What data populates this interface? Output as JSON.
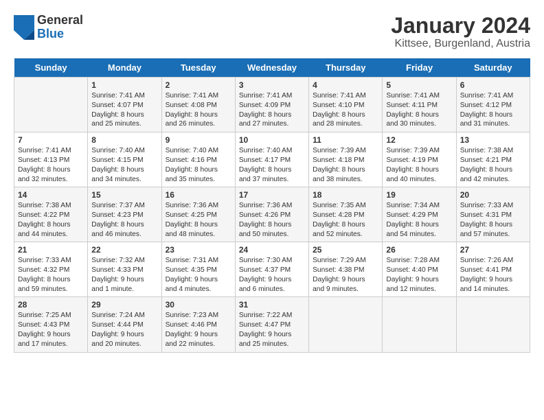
{
  "header": {
    "logo": {
      "general": "General",
      "blue": "Blue"
    },
    "title": "January 2024",
    "subtitle": "Kittsee, Burgenland, Austria"
  },
  "days_of_week": [
    "Sunday",
    "Monday",
    "Tuesday",
    "Wednesday",
    "Thursday",
    "Friday",
    "Saturday"
  ],
  "weeks": [
    [
      {
        "day": "",
        "content": ""
      },
      {
        "day": "1",
        "content": "Sunrise: 7:41 AM\nSunset: 4:07 PM\nDaylight: 8 hours\nand 25 minutes."
      },
      {
        "day": "2",
        "content": "Sunrise: 7:41 AM\nSunset: 4:08 PM\nDaylight: 8 hours\nand 26 minutes."
      },
      {
        "day": "3",
        "content": "Sunrise: 7:41 AM\nSunset: 4:09 PM\nDaylight: 8 hours\nand 27 minutes."
      },
      {
        "day": "4",
        "content": "Sunrise: 7:41 AM\nSunset: 4:10 PM\nDaylight: 8 hours\nand 28 minutes."
      },
      {
        "day": "5",
        "content": "Sunrise: 7:41 AM\nSunset: 4:11 PM\nDaylight: 8 hours\nand 30 minutes."
      },
      {
        "day": "6",
        "content": "Sunrise: 7:41 AM\nSunset: 4:12 PM\nDaylight: 8 hours\nand 31 minutes."
      }
    ],
    [
      {
        "day": "7",
        "content": "Sunrise: 7:41 AM\nSunset: 4:13 PM\nDaylight: 8 hours\nand 32 minutes."
      },
      {
        "day": "8",
        "content": "Sunrise: 7:40 AM\nSunset: 4:15 PM\nDaylight: 8 hours\nand 34 minutes."
      },
      {
        "day": "9",
        "content": "Sunrise: 7:40 AM\nSunset: 4:16 PM\nDaylight: 8 hours\nand 35 minutes."
      },
      {
        "day": "10",
        "content": "Sunrise: 7:40 AM\nSunset: 4:17 PM\nDaylight: 8 hours\nand 37 minutes."
      },
      {
        "day": "11",
        "content": "Sunrise: 7:39 AM\nSunset: 4:18 PM\nDaylight: 8 hours\nand 38 minutes."
      },
      {
        "day": "12",
        "content": "Sunrise: 7:39 AM\nSunset: 4:19 PM\nDaylight: 8 hours\nand 40 minutes."
      },
      {
        "day": "13",
        "content": "Sunrise: 7:38 AM\nSunset: 4:21 PM\nDaylight: 8 hours\nand 42 minutes."
      }
    ],
    [
      {
        "day": "14",
        "content": "Sunrise: 7:38 AM\nSunset: 4:22 PM\nDaylight: 8 hours\nand 44 minutes."
      },
      {
        "day": "15",
        "content": "Sunrise: 7:37 AM\nSunset: 4:23 PM\nDaylight: 8 hours\nand 46 minutes."
      },
      {
        "day": "16",
        "content": "Sunrise: 7:36 AM\nSunset: 4:25 PM\nDaylight: 8 hours\nand 48 minutes."
      },
      {
        "day": "17",
        "content": "Sunrise: 7:36 AM\nSunset: 4:26 PM\nDaylight: 8 hours\nand 50 minutes."
      },
      {
        "day": "18",
        "content": "Sunrise: 7:35 AM\nSunset: 4:28 PM\nDaylight: 8 hours\nand 52 minutes."
      },
      {
        "day": "19",
        "content": "Sunrise: 7:34 AM\nSunset: 4:29 PM\nDaylight: 8 hours\nand 54 minutes."
      },
      {
        "day": "20",
        "content": "Sunrise: 7:33 AM\nSunset: 4:31 PM\nDaylight: 8 hours\nand 57 minutes."
      }
    ],
    [
      {
        "day": "21",
        "content": "Sunrise: 7:33 AM\nSunset: 4:32 PM\nDaylight: 8 hours\nand 59 minutes."
      },
      {
        "day": "22",
        "content": "Sunrise: 7:32 AM\nSunset: 4:33 PM\nDaylight: 9 hours\nand 1 minute."
      },
      {
        "day": "23",
        "content": "Sunrise: 7:31 AM\nSunset: 4:35 PM\nDaylight: 9 hours\nand 4 minutes."
      },
      {
        "day": "24",
        "content": "Sunrise: 7:30 AM\nSunset: 4:37 PM\nDaylight: 9 hours\nand 6 minutes."
      },
      {
        "day": "25",
        "content": "Sunrise: 7:29 AM\nSunset: 4:38 PM\nDaylight: 9 hours\nand 9 minutes."
      },
      {
        "day": "26",
        "content": "Sunrise: 7:28 AM\nSunset: 4:40 PM\nDaylight: 9 hours\nand 12 minutes."
      },
      {
        "day": "27",
        "content": "Sunrise: 7:26 AM\nSunset: 4:41 PM\nDaylight: 9 hours\nand 14 minutes."
      }
    ],
    [
      {
        "day": "28",
        "content": "Sunrise: 7:25 AM\nSunset: 4:43 PM\nDaylight: 9 hours\nand 17 minutes."
      },
      {
        "day": "29",
        "content": "Sunrise: 7:24 AM\nSunset: 4:44 PM\nDaylight: 9 hours\nand 20 minutes."
      },
      {
        "day": "30",
        "content": "Sunrise: 7:23 AM\nSunset: 4:46 PM\nDaylight: 9 hours\nand 22 minutes."
      },
      {
        "day": "31",
        "content": "Sunrise: 7:22 AM\nSunset: 4:47 PM\nDaylight: 9 hours\nand 25 minutes."
      },
      {
        "day": "",
        "content": ""
      },
      {
        "day": "",
        "content": ""
      },
      {
        "day": "",
        "content": ""
      }
    ]
  ]
}
